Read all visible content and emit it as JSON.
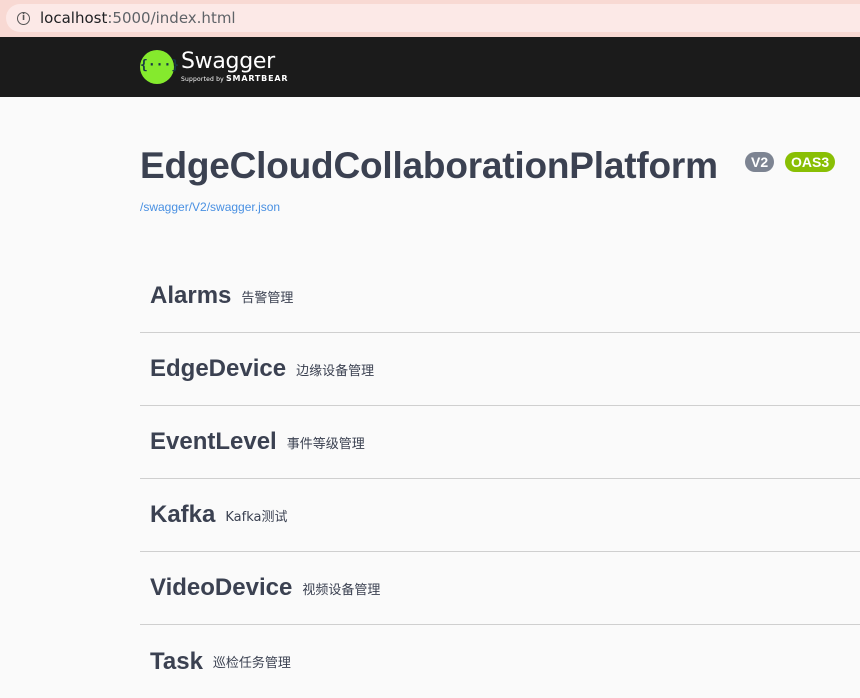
{
  "browser": {
    "url_host": "localhost",
    "url_path": ":5000/index.html"
  },
  "topbar": {
    "logo_icon_text": "{···}",
    "logo_title": "Swagger",
    "logo_supported_by": "Supported by",
    "logo_brand": "SMARTBEAR",
    "background_color": "#1b1b1b",
    "accent_color": "#85ea2d"
  },
  "info": {
    "title": "EdgeCloudCollaborationPlatform",
    "version_badge": "V2",
    "oas_badge": "OAS3",
    "spec_link": "/swagger/V2/swagger.json"
  },
  "tags": [
    {
      "name": "Alarms",
      "description": "告警管理"
    },
    {
      "name": "EdgeDevice",
      "description": "边缘设备管理"
    },
    {
      "name": "EventLevel",
      "description": "事件等级管理"
    },
    {
      "name": "Kafka",
      "description": "Kafka测试"
    },
    {
      "name": "VideoDevice",
      "description": "视频设备管理"
    },
    {
      "name": "Task",
      "description": "巡检任务管理"
    }
  ]
}
